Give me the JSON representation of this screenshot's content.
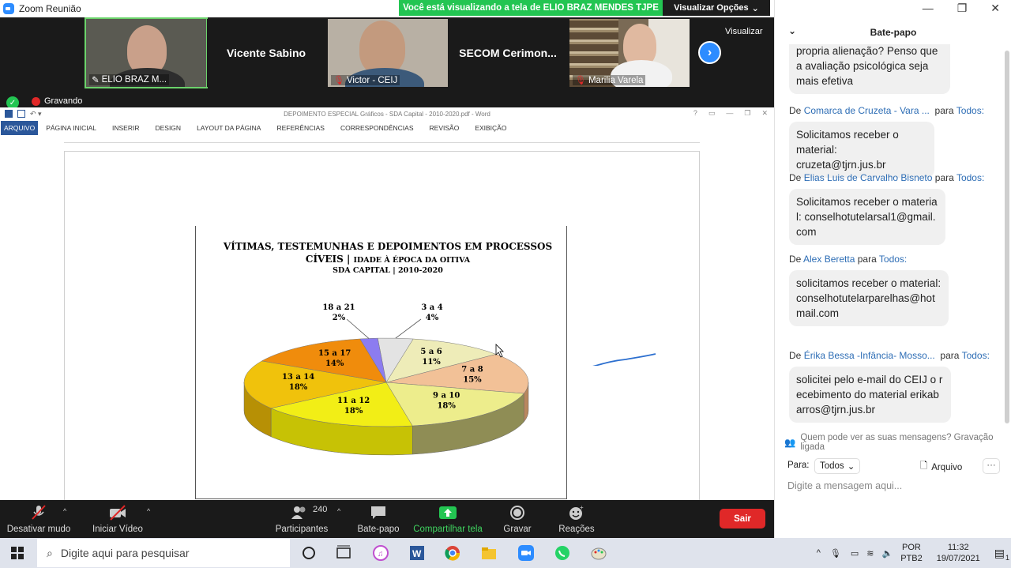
{
  "window": {
    "title": "Zoom Reunião",
    "share_banner": "Você está visualizando a tela de ELIO BRAZ MENDES TJPE",
    "view_options": "Visualizar Opções"
  },
  "participants": {
    "tiles": [
      {
        "name": "ELIO BRAZ M..."
      },
      {
        "name": "Vicente Sabino"
      },
      {
        "name": "Victor - CEIJ"
      },
      {
        "name": "SECOM  Cerimon..."
      },
      {
        "name": "Marilia Varela"
      }
    ],
    "visualizar": "Visualizar",
    "recording": "Gravando"
  },
  "word": {
    "title": "DEPOIMENTO ESPECIAL Gráficos - SDA Capital - 2010-2020.pdf - Word",
    "tabs": [
      "ARQUIVO",
      "PÁGINA INICIAL",
      "INSERIR",
      "DESIGN",
      "LAYOUT DA PÁGINA",
      "REFERÊNCIAS",
      "CORRESPONDÊNCIAS",
      "REVISÃO",
      "EXIBIÇÃO"
    ]
  },
  "chart_data": {
    "type": "pie",
    "title_line1": "VÍTIMAS, TESTEMUNHAS E DEPOIMENTOS EM PROCESSOS",
    "title_line2_a": "CÍVEIS | ",
    "title_line2_b": "IDADE À ÉPOCA DA OITIVA",
    "subtitle": "SDA CAPITAL | 2010-2020",
    "slices": [
      {
        "label": "3 a 4",
        "value": 4,
        "pct": "4%",
        "color": "#e3e3e3",
        "side": "#a8a8a8"
      },
      {
        "label": "5 a 6",
        "value": 11,
        "pct": "11%",
        "color": "#eeecb8",
        "side": "#b3b184"
      },
      {
        "label": "7 a 8",
        "value": 15,
        "pct": "15%",
        "color": "#f2c197",
        "side": "#b8875e"
      },
      {
        "label": "9 a 10",
        "value": 18,
        "pct": "18%",
        "color": "#eded8c",
        "side": "#8f8d55"
      },
      {
        "label": "11 a 12",
        "value": 18,
        "pct": "18%",
        "color": "#f2ee16",
        "side": "#c7c205"
      },
      {
        "label": "13 a 14",
        "value": 18,
        "pct": "18%",
        "color": "#f0c20c",
        "side": "#b79005"
      },
      {
        "label": "15 a 17",
        "value": 14,
        "pct": "14%",
        "color": "#f08c0c",
        "side": "#b86505"
      },
      {
        "label": "18 a 21",
        "value": 2,
        "pct": "2%",
        "color": "#8c7cf0",
        "side": "#5b4fb0"
      }
    ]
  },
  "toolbar": {
    "mute": "Desativar mudo",
    "video": "Iniciar Vídeo",
    "participants": "Participantes",
    "participant_count": "240",
    "chat": "Bate-papo",
    "share": "Compartilhar tela",
    "record": "Gravar",
    "reactions": "Reações",
    "leave": "Sair"
  },
  "chat": {
    "title": "Bate-papo",
    "to_label": "para",
    "to_target": "Todos:",
    "first_bubble": "propria alienação? Penso que a avaliação psicológica seja mais efetiva",
    "messages": [
      {
        "sender": "Comarca de Cruzeta - Vara ...",
        "text": "Solicitamos receber o material: cruzeta@tjrn.jus.br"
      },
      {
        "sender": "Elias Luis de Carvalho Bisneto",
        "text": "Solicitamos receber o material: conselhotutelarsal1@gmail.com"
      },
      {
        "sender": "Alex Beretta",
        "text": "solicitamos receber o material: conselhotutelarparelhas@hotmail.com"
      },
      {
        "sender": "Érika Bessa -Infância- Mosso...",
        "text": "solicitei pelo e-mail do CEIJ o recebimento do material erikabarros@tjrn.jus.br"
      }
    ],
    "from_prefix": "De",
    "notice": "Quem pode ver as suas mensagens? Gravação ligada",
    "send_to_label": "Para:",
    "send_to_value": "Todos",
    "file_label": "Arquivo",
    "input_placeholder": "Digite a mensagem aqui..."
  },
  "taskbar": {
    "search_placeholder": "Digite aqui para pesquisar",
    "lang": "POR",
    "layout": "PTB2",
    "time": "11:32",
    "date": "19/07/2021",
    "notif_count": "1"
  }
}
